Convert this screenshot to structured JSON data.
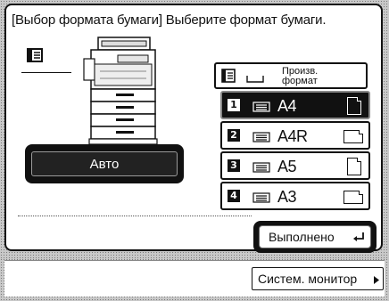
{
  "dialog": {
    "title": "[Выбор формата бумаги] Выберите формат бумаги.",
    "auto_label": "Авто",
    "done_label": "Выполнено"
  },
  "paper_source": {
    "custom_label_line1": "Произв.",
    "custom_label_line2": "формат",
    "trays": [
      {
        "number": "1",
        "size": "A4",
        "orientation": "portrait",
        "selected": true
      },
      {
        "number": "2",
        "size": "A4R",
        "orientation": "landscape",
        "selected": false
      },
      {
        "number": "3",
        "size": "A5",
        "orientation": "portrait",
        "selected": false
      },
      {
        "number": "4",
        "size": "A3",
        "orientation": "landscape",
        "selected": false
      }
    ]
  },
  "footer": {
    "system_monitor_label": "Систем. монитор"
  }
}
